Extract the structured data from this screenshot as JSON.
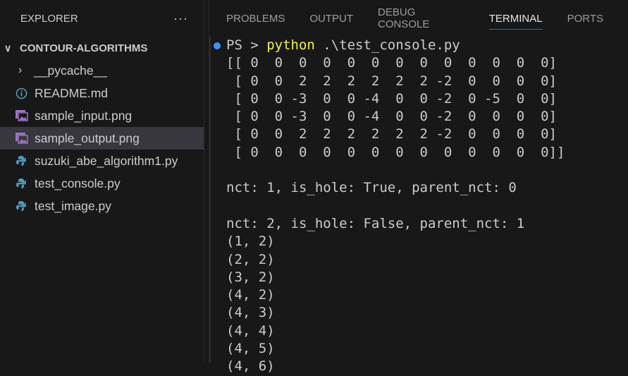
{
  "sidebar": {
    "title": "EXPLORER",
    "more": "···",
    "folder": "CONTOUR-ALGORITHMS",
    "items": [
      {
        "label": "__pycache__",
        "icon": "chevron-right-icon"
      },
      {
        "label": "README.md",
        "icon": "info-icon"
      },
      {
        "label": "sample_input.png",
        "icon": "image-icon"
      },
      {
        "label": "sample_output.png",
        "icon": "image-icon"
      },
      {
        "label": "suzuki_abe_algorithm1.py",
        "icon": "python-icon"
      },
      {
        "label": "test_console.py",
        "icon": "python-icon"
      },
      {
        "label": "test_image.py",
        "icon": "python-icon"
      }
    ]
  },
  "tabs": [
    "PROBLEMS",
    "OUTPUT",
    "DEBUG CONSOLE",
    "TERMINAL",
    "PORTS"
  ],
  "terminal": {
    "prompt": "PS > ",
    "command": "python",
    "args": " .\\test_console.py",
    "lines": [
      "[[ 0  0  0  0  0  0  0  0  0  0  0  0  0]",
      " [ 0  0  2  2  2  2  2  2 -2  0  0  0  0]",
      " [ 0  0 -3  0  0 -4  0  0 -2  0 -5  0  0]",
      " [ 0  0 -3  0  0 -4  0  0 -2  0  0  0  0]",
      " [ 0  0  2  2  2  2  2  2 -2  0  0  0  0]",
      " [ 0  0  0  0  0  0  0  0  0  0  0  0  0]]",
      "",
      "nct: 1, is_hole: True, parent_nct: 0",
      "",
      "nct: 2, is_hole: False, parent_nct: 1",
      "(1, 2)",
      "(2, 2)",
      "(3, 2)",
      "(4, 2)",
      "(4, 3)",
      "(4, 4)",
      "(4, 5)",
      "(4, 6)"
    ]
  }
}
